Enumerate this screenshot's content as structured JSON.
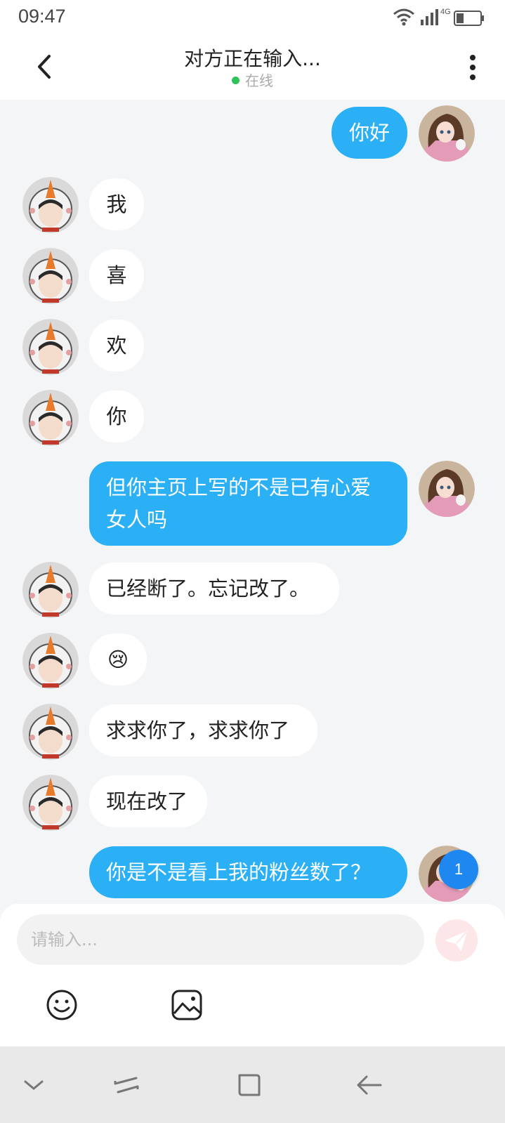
{
  "status": {
    "time": "09:47",
    "network": "4G"
  },
  "header": {
    "title": "对方正在输入...",
    "online_label": "在线"
  },
  "messages": [
    {
      "side": "out",
      "text": "你好"
    },
    {
      "side": "in",
      "text": "我"
    },
    {
      "side": "in",
      "text": "喜"
    },
    {
      "side": "in",
      "text": "欢"
    },
    {
      "side": "in",
      "text": "你"
    },
    {
      "side": "out",
      "text": "但你主页上写的不是已有心爱女人吗"
    },
    {
      "side": "in",
      "text": "已经断了。忘记改了。"
    },
    {
      "side": "in",
      "text": "😢"
    },
    {
      "side": "in",
      "text": "求求你了，求求你了"
    },
    {
      "side": "in",
      "text": "现在改了"
    },
    {
      "side": "out",
      "text": "你是不是看上我的粉丝数了？"
    }
  ],
  "unread_badge": "1",
  "composer": {
    "placeholder": "请输入..."
  },
  "colors": {
    "out_bubble": "#2bb0f5",
    "in_bubble": "#ffffff",
    "background": "#f4f5f7",
    "online": "#2fc25b"
  },
  "icons": [
    "back-icon",
    "more-icon",
    "emoji-icon",
    "image-icon",
    "send-icon",
    "nav-down-icon",
    "nav-recent-icon",
    "nav-home-icon",
    "nav-back-icon"
  ]
}
